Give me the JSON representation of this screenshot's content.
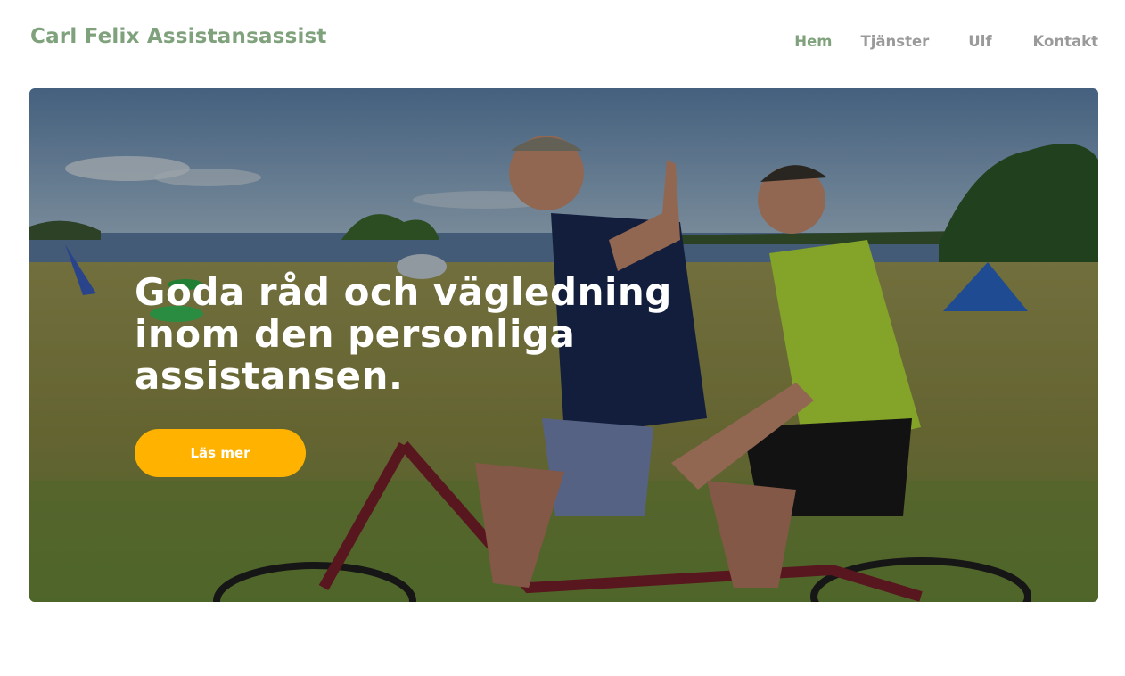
{
  "header": {
    "brand": "Carl Felix Assistansassist",
    "nav": [
      {
        "label": "Hem",
        "active": true
      },
      {
        "label": "Tjänster",
        "active": false
      },
      {
        "label": "Ulf",
        "active": false
      },
      {
        "label": "Kontakt",
        "active": false
      }
    ]
  },
  "hero": {
    "title": "Goda råd och vägledning inom den personliga assistansen.",
    "button_label": "Läs mer",
    "image_description_icon": "beach-tandem-bike-photo"
  },
  "colors": {
    "brand": "#7fa27c",
    "nav_inactive": "#9a9a9a",
    "button": "#ffb300",
    "hero_text": "#ffffff"
  }
}
